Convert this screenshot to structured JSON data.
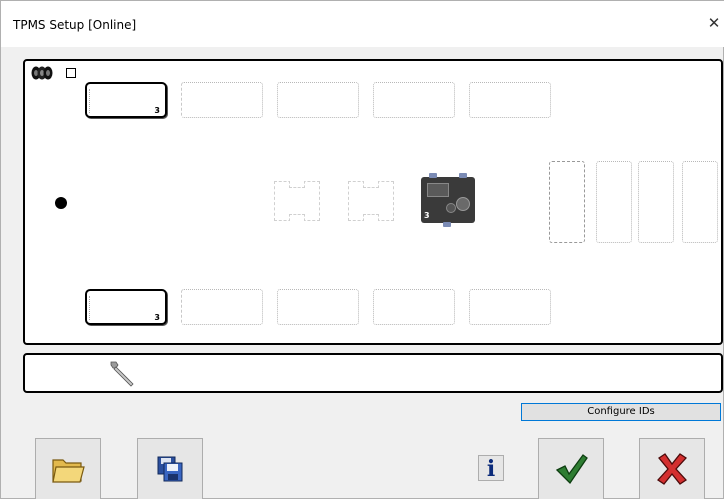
{
  "window": {
    "title": "TPMS Setup  [Online]",
    "close_glyph": "✕"
  },
  "axles": {
    "front_left_number": "3",
    "front_right_number": "3",
    "ecu_number": "3"
  },
  "buttons": {
    "configure_ids": "Configure IDs",
    "info_glyph": "i"
  },
  "icons": {
    "tires": "tires-icon",
    "wrench": "wrench-icon",
    "open": "folder-icon",
    "save": "floppy-disk-icon",
    "info": "info-icon",
    "ok": "checkmark-icon",
    "cancel": "cross-icon"
  },
  "colors": {
    "ok": "#2e7d32",
    "cancel": "#c62828",
    "accent": "#0078d7"
  }
}
